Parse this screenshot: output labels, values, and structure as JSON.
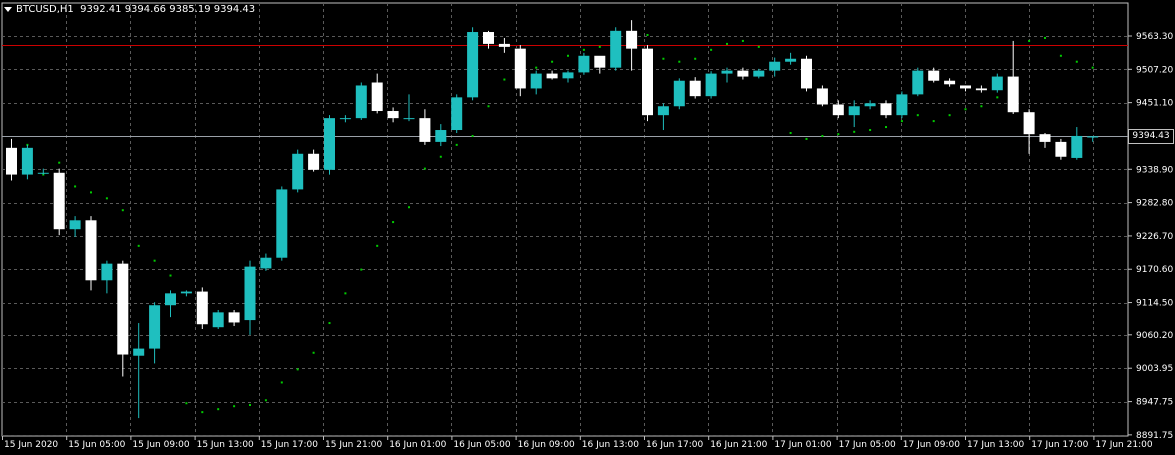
{
  "header": {
    "symbol_timeframe": "BTCUSD,H1",
    "ohlc": "9392.41 9394.66 9385.19 9394.43"
  },
  "current_price_label": "9394.43",
  "colors": {
    "background": "#000000",
    "grid": "#5a5a5a",
    "bull": "#1fbfbf",
    "bear": "#ffffff",
    "wick_bull": "#1fbfbf",
    "wick_bear": "#ffffff",
    "sar": "#00cc00",
    "resistance_line": "#cc0000",
    "current_price_line": "#9aa0a8"
  },
  "chart_data": {
    "type": "candlestick",
    "symbol": "BTCUSD",
    "timeframe": "H1",
    "ylim": [
      8891.75,
      9590
    ],
    "y_ticks": [
      "9563.30",
      "9507.20",
      "9451.10",
      "9394.43",
      "9338.90",
      "9282.80",
      "9226.70",
      "9170.60",
      "9114.50",
      "9060.20",
      "9003.95",
      "8947.75",
      "8891.75"
    ],
    "y_tick_values": [
      9563.3,
      9507.2,
      9451.1,
      9394.43,
      9338.9,
      9282.8,
      9226.7,
      9170.6,
      9114.5,
      9060.2,
      9003.95,
      8947.75,
      8891.75
    ],
    "x_ticks": [
      "15 Jun 2020",
      "15 Jun 05:00",
      "15 Jun 09:00",
      "15 Jun 13:00",
      "15 Jun 17:00",
      "15 Jun 21:00",
      "16 Jun 01:00",
      "16 Jun 05:00",
      "16 Jun 09:00",
      "16 Jun 13:00",
      "16 Jun 17:00",
      "16 Jun 21:00",
      "17 Jun 01:00",
      "17 Jun 05:00",
      "17 Jun 09:00",
      "17 Jun 13:00",
      "17 Jun 17:00",
      "17 Jun 21:00"
    ],
    "horizontal_lines": [
      {
        "price": 9548,
        "style": "resistance"
      },
      {
        "price": 9394.43,
        "style": "current"
      }
    ],
    "candles": [
      [
        9375,
        9330,
        9390,
        9320
      ],
      [
        9330,
        9375,
        9380,
        9322
      ],
      [
        9333,
        9333,
        9340,
        9330
      ],
      [
        9333,
        9238,
        9340,
        9228
      ],
      [
        9238,
        9253,
        9260,
        9225
      ],
      [
        9253,
        9152,
        9260,
        9135
      ],
      [
        9152,
        9180,
        9185,
        9130
      ],
      [
        9180,
        9027,
        9185,
        8990
      ],
      [
        9025,
        9037,
        9080,
        8920
      ],
      [
        9037,
        9110,
        9115,
        9012
      ],
      [
        9110,
        9130,
        9135,
        9090
      ],
      [
        9130,
        9133,
        9135,
        9125
      ],
      [
        9133,
        9078,
        9140,
        9070
      ],
      [
        9073,
        9098,
        9102,
        9070
      ],
      [
        9098,
        9081,
        9102,
        9075
      ],
      [
        9085,
        9175,
        9185,
        9060
      ],
      [
        9172,
        9190,
        9197,
        9168
      ],
      [
        9190,
        9305,
        9310,
        9185
      ],
      [
        9305,
        9365,
        9372,
        9300
      ],
      [
        9365,
        9338,
        9372,
        9335
      ],
      [
        9338,
        9425,
        9430,
        9330
      ],
      [
        9425,
        9425,
        9430,
        9418
      ],
      [
        9425,
        9480,
        9485,
        9422
      ],
      [
        9485,
        9437,
        9500,
        9433
      ],
      [
        9437,
        9425,
        9443,
        9418
      ],
      [
        9425,
        9425,
        9465,
        9420
      ],
      [
        9425,
        9385,
        9440,
        9380
      ],
      [
        9385,
        9405,
        9415,
        9378
      ],
      [
        9405,
        9460,
        9465,
        9400
      ],
      [
        9460,
        9570,
        9578,
        9455
      ],
      [
        9570,
        9550,
        9572,
        9542
      ],
      [
        9550,
        9545,
        9560,
        9535
      ],
      [
        9542,
        9475,
        9548,
        9462
      ],
      [
        9475,
        9500,
        9505,
        9465
      ],
      [
        9500,
        9492,
        9505,
        9490
      ],
      [
        9492,
        9502,
        9505,
        9485
      ],
      [
        9502,
        9530,
        9535,
        9498
      ],
      [
        9530,
        9510,
        9520,
        9500
      ],
      [
        9510,
        9572,
        9578,
        9505
      ],
      [
        9572,
        9542,
        9590,
        9505
      ],
      [
        9542,
        9430,
        9548,
        9420
      ],
      [
        9430,
        9445,
        9450,
        9405
      ],
      [
        9445,
        9488,
        9492,
        9440
      ],
      [
        9488,
        9462,
        9494,
        9458
      ],
      [
        9462,
        9500,
        9504,
        9458
      ],
      [
        9500,
        9505,
        9510,
        9485
      ],
      [
        9505,
        9495,
        9510,
        9490
      ],
      [
        9495,
        9505,
        9508,
        9492
      ],
      [
        9505,
        9520,
        9527,
        9495
      ],
      [
        9520,
        9525,
        9535,
        9515
      ],
      [
        9525,
        9475,
        9530,
        9470
      ],
      [
        9475,
        9448,
        9480,
        9445
      ],
      [
        9448,
        9430,
        9455,
        9425
      ],
      [
        9430,
        9445,
        9455,
        9410
      ],
      [
        9445,
        9450,
        9455,
        9440
      ],
      [
        9450,
        9430,
        9455,
        9425
      ],
      [
        9430,
        9465,
        9470,
        9425
      ],
      [
        9465,
        9505,
        9510,
        9462
      ],
      [
        9505,
        9488,
        9510,
        9485
      ],
      [
        9488,
        9482,
        9492,
        9478
      ],
      [
        9480,
        9475,
        9480,
        9470
      ],
      [
        9475,
        9472,
        9480,
        9468
      ],
      [
        9472,
        9495,
        9500,
        9468
      ],
      [
        9495,
        9435,
        9555,
        9432
      ],
      [
        9435,
        9398,
        9440,
        9365
      ],
      [
        9398,
        9385,
        9400,
        9375
      ],
      [
        9385,
        9360,
        9390,
        9355
      ],
      [
        9358,
        9395,
        9410,
        9355
      ],
      [
        9392.41,
        9394.43,
        9394.66,
        9385.19
      ]
    ],
    "sar": [
      9345,
      9380,
      9330,
      9350,
      9310,
      9300,
      9290,
      9270,
      9210,
      9185,
      9160,
      8945,
      8930,
      8935,
      8940,
      8942,
      8950,
      8980,
      9002,
      9030,
      9080,
      9130,
      9170,
      9210,
      9250,
      9275,
      9340,
      9360,
      9380,
      9395,
      9445,
      9490,
      9505,
      9510,
      9520,
      9530,
      9540,
      9545,
      9550,
      9555,
      9565,
      9525,
      9520,
      9525,
      9540,
      9550,
      9555,
      9545,
      9510,
      9400,
      9390,
      9395,
      9398,
      9402,
      9405,
      9410,
      9420,
      9430,
      9420,
      9430,
      9440,
      9445,
      9460,
      9470,
      9555,
      9560,
      9530,
      9520,
      9510
    ]
  }
}
